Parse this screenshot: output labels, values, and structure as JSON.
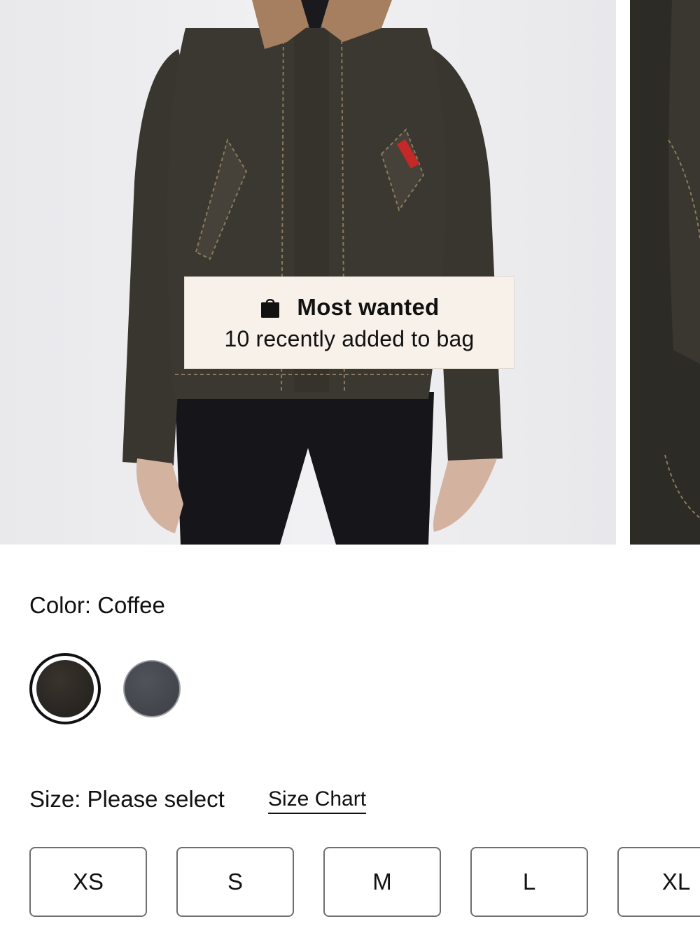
{
  "product_gallery": {
    "images": [
      {
        "icon": "jacket-photo",
        "description_shown": false
      },
      {
        "icon": "jacket-photo-next",
        "description_shown": false
      }
    ]
  },
  "badge": {
    "icon": "shopping-bag-icon",
    "title": "Most wanted",
    "subtitle": "10 recently added to bag"
  },
  "color": {
    "label": "Color: Coffee",
    "swatches": [
      {
        "name": "Coffee",
        "hex": "#2a2622",
        "selected": true
      },
      {
        "name": "",
        "hex": "#44474e",
        "selected": false
      }
    ]
  },
  "size": {
    "label": "Size: Please select",
    "chart_link": "Size Chart",
    "options": [
      "XS",
      "S",
      "M",
      "L",
      "XL"
    ]
  },
  "colors": {
    "badge_bg": "#f8f1ea",
    "text": "#111111",
    "button_border": "#6f6f6f"
  }
}
